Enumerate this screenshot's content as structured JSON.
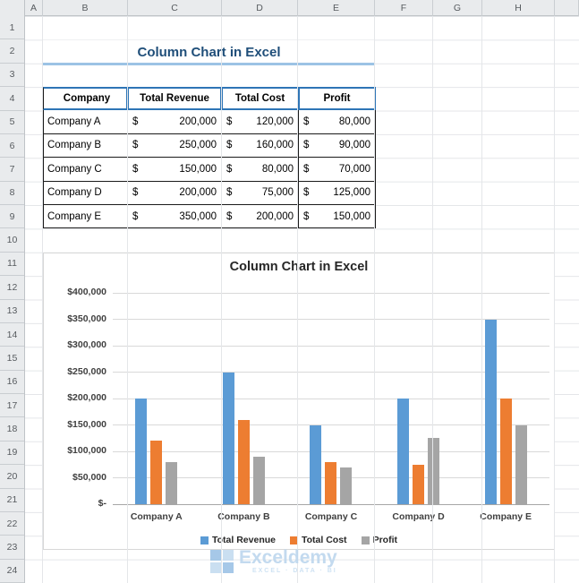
{
  "grid": {
    "column_letters": [
      "A",
      "B",
      "C",
      "D",
      "E",
      "F",
      "G",
      "H"
    ],
    "row_numbers": [
      1,
      2,
      3,
      4,
      5,
      6,
      7,
      8,
      9,
      10,
      11,
      12,
      13,
      14,
      15,
      16,
      17,
      18,
      19,
      20,
      21,
      22,
      23,
      24
    ]
  },
  "sheet": {
    "title": "Column Chart in Excel"
  },
  "table": {
    "headers": [
      "Company",
      "Total Revenue",
      "Total Cost",
      "Profit"
    ],
    "currency_symbol": "$",
    "rows": [
      {
        "company": "Company A",
        "revenue": "200,000",
        "cost": "120,000",
        "profit": "80,000"
      },
      {
        "company": "Company B",
        "revenue": "250,000",
        "cost": "160,000",
        "profit": "90,000"
      },
      {
        "company": "Company C",
        "revenue": "150,000",
        "cost": "80,000",
        "profit": "70,000"
      },
      {
        "company": "Company D",
        "revenue": "200,000",
        "cost": "75,000",
        "profit": "125,000"
      },
      {
        "company": "Company E",
        "revenue": "350,000",
        "cost": "200,000",
        "profit": "150,000"
      }
    ]
  },
  "chart_data": {
    "type": "bar",
    "title": "Column Chart in Excel",
    "categories": [
      "Company A",
      "Company B",
      "Company C",
      "Company D",
      "Company E"
    ],
    "series": [
      {
        "name": "Total Revenue",
        "color": "#5B9BD5",
        "values": [
          200000,
          250000,
          150000,
          200000,
          350000
        ]
      },
      {
        "name": "Total Cost",
        "color": "#ED7D31",
        "values": [
          120000,
          160000,
          80000,
          75000,
          200000
        ]
      },
      {
        "name": "Profit",
        "color": "#A5A5A5",
        "values": [
          80000,
          90000,
          70000,
          125000,
          150000
        ]
      }
    ],
    "ylim": [
      0,
      400000
    ],
    "ytick_step": 50000,
    "ytick_labels": [
      "$-",
      "$50,000",
      "$100,000",
      "$150,000",
      "$200,000",
      "$250,000",
      "$300,000",
      "$350,000",
      "$400,000"
    ],
    "grid": true,
    "legend_position": "bottom"
  },
  "watermark": {
    "name": "Exceldemy",
    "tagline": "EXCEL · DATA · BI"
  }
}
